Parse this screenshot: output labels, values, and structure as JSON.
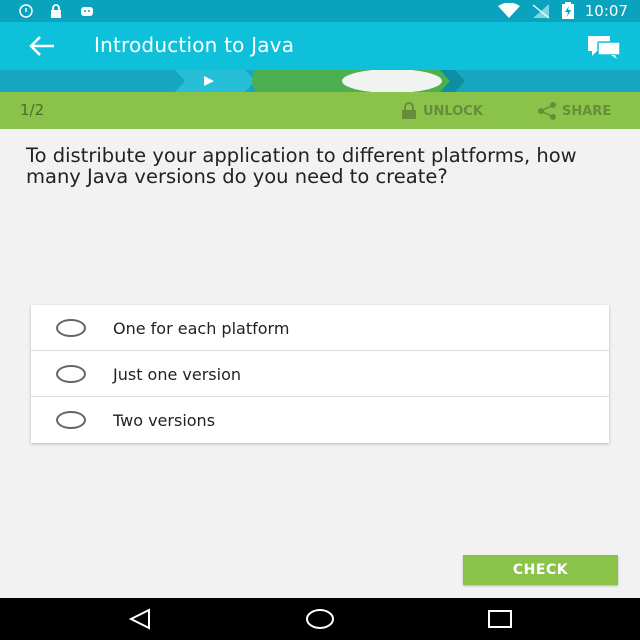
{
  "status_bar": {
    "time": "10:07",
    "icons": [
      "alarm-icon",
      "lock-icon",
      "android-icon",
      "wifi-icon",
      "no-signal-icon",
      "battery-charging-icon"
    ]
  },
  "app_bar": {
    "title": "Introduction to Java",
    "back_icon": "back-arrow-icon",
    "comments_icon": "comments-icon"
  },
  "lesson_bar": {
    "page_counter": "1/2",
    "unlock_label": "UNLOCK",
    "share_label": "SHARE"
  },
  "question": {
    "text": "To distribute your application to different platforms, how many Java versions do you need to create?"
  },
  "options": [
    {
      "label": "One for each platform"
    },
    {
      "label": "Just one version"
    },
    {
      "label": "Two versions"
    }
  ],
  "actions": {
    "check_label": "CHECK"
  },
  "colors": {
    "status_bar": "#0aa3bd",
    "app_bar": "#0fc0da",
    "progress_strip": "#16a7be",
    "lesson_bar": "#8bc34a",
    "check_button": "#8bc34a",
    "progress_marker": "#4caf50"
  }
}
